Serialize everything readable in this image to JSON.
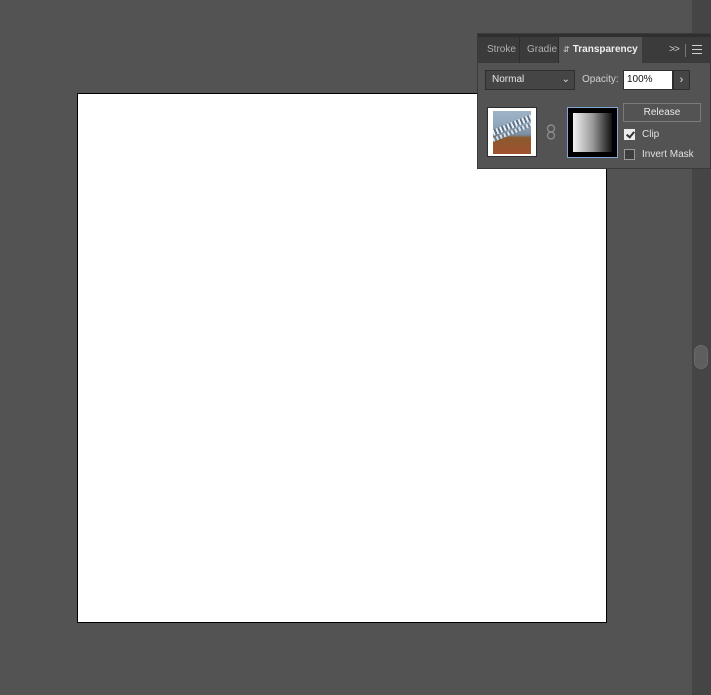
{
  "panel": {
    "tabs": [
      {
        "label": "Stroke"
      },
      {
        "label": "Gradie"
      },
      {
        "label": "Transparency"
      }
    ],
    "collapse_label": ">>",
    "blend_mode": "Normal",
    "opacity_label": "Opacity:",
    "opacity_value": "100%",
    "release_label": "Release",
    "clip_label": "Clip",
    "clip_checked": true,
    "invert_mask_label": "Invert Mask",
    "invert_mask_checked": false
  },
  "colors": {
    "workspace_bg": "#535353",
    "artboard_bg": "#ffffff",
    "panel_bg": "#535353",
    "tabbar_bg": "#3b3b3b",
    "mask_highlight": "#7fa6d6"
  },
  "icons": [
    "chevron-down-icon",
    "chevron-right-icon",
    "panel-menu-icon",
    "link-icon",
    "collapse-icon"
  ]
}
